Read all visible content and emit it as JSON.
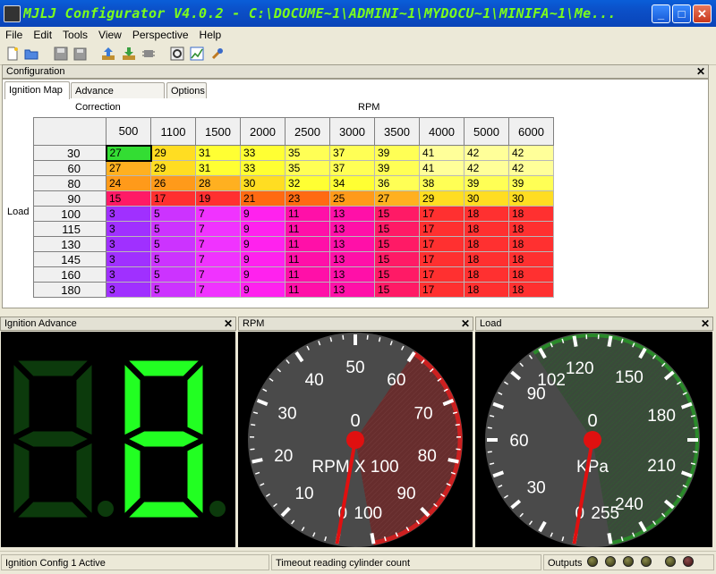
{
  "window": {
    "title": "MJLJ Configurator V4.0.2 - C:\\DOCUME~1\\ADMINI~1\\MYDOCU~1\\MINIFA~1\\Me...",
    "minimize_label": "_",
    "maximize_label": "□",
    "close_label": "✕"
  },
  "menu": [
    "File",
    "Edit",
    "Tools",
    "View",
    "Perspective",
    "Help"
  ],
  "config_panel": {
    "title": "Configuration",
    "tabs": [
      "Ignition Map",
      "Advance Correction",
      "Options"
    ],
    "active_tab": 0,
    "rpm_axis_label": "RPM",
    "load_axis_label": "Load"
  },
  "ignition_map": {
    "rpm": [
      "500",
      "1100",
      "1500",
      "2000",
      "2500",
      "3000",
      "3500",
      "4000",
      "5000",
      "6000"
    ],
    "load": [
      "30",
      "60",
      "80",
      "90",
      "100",
      "115",
      "130",
      "145",
      "160",
      "180"
    ],
    "values": [
      [
        27,
        29,
        31,
        33,
        35,
        37,
        39,
        41,
        42,
        42
      ],
      [
        27,
        29,
        31,
        33,
        35,
        37,
        39,
        41,
        42,
        42
      ],
      [
        24,
        26,
        28,
        30,
        32,
        34,
        36,
        38,
        39,
        39
      ],
      [
        15,
        17,
        19,
        21,
        23,
        25,
        27,
        29,
        30,
        30
      ],
      [
        3,
        5,
        7,
        9,
        11,
        13,
        15,
        17,
        18,
        18
      ],
      [
        3,
        5,
        7,
        9,
        11,
        13,
        15,
        17,
        18,
        18
      ],
      [
        3,
        5,
        7,
        9,
        11,
        13,
        15,
        17,
        18,
        18
      ],
      [
        3,
        5,
        7,
        9,
        11,
        13,
        15,
        17,
        18,
        18
      ],
      [
        3,
        5,
        7,
        9,
        11,
        13,
        15,
        17,
        18,
        18
      ],
      [
        3,
        5,
        7,
        9,
        11,
        13,
        15,
        17,
        18,
        18
      ]
    ],
    "selected_cell": [
      0,
      0
    ]
  },
  "ignition_advance_panel": {
    "title": "Ignition Advance",
    "digit_color": "#22ff22",
    "dim_color": "#0c3a0c"
  },
  "rpm_panel": {
    "title": "RPM",
    "value": "0",
    "unit_label": "RPM X 100",
    "ticks": [
      "0",
      "10",
      "20",
      "30",
      "40",
      "50",
      "60",
      "70",
      "80",
      "90",
      "100"
    ],
    "redline_color": "#cc2020"
  },
  "load_panel": {
    "title": "Load",
    "value": "0",
    "unit_label": "KPa",
    "ticks": [
      "0",
      "30",
      "60",
      "90",
      "102",
      "120",
      "150",
      "180",
      "210",
      "240",
      "255"
    ],
    "zone_color": "#2a8a2a"
  },
  "statusbar": {
    "left": "Ignition Config 1 Active",
    "center": "Timeout reading cylinder count",
    "outputs_label": "Outputs"
  }
}
